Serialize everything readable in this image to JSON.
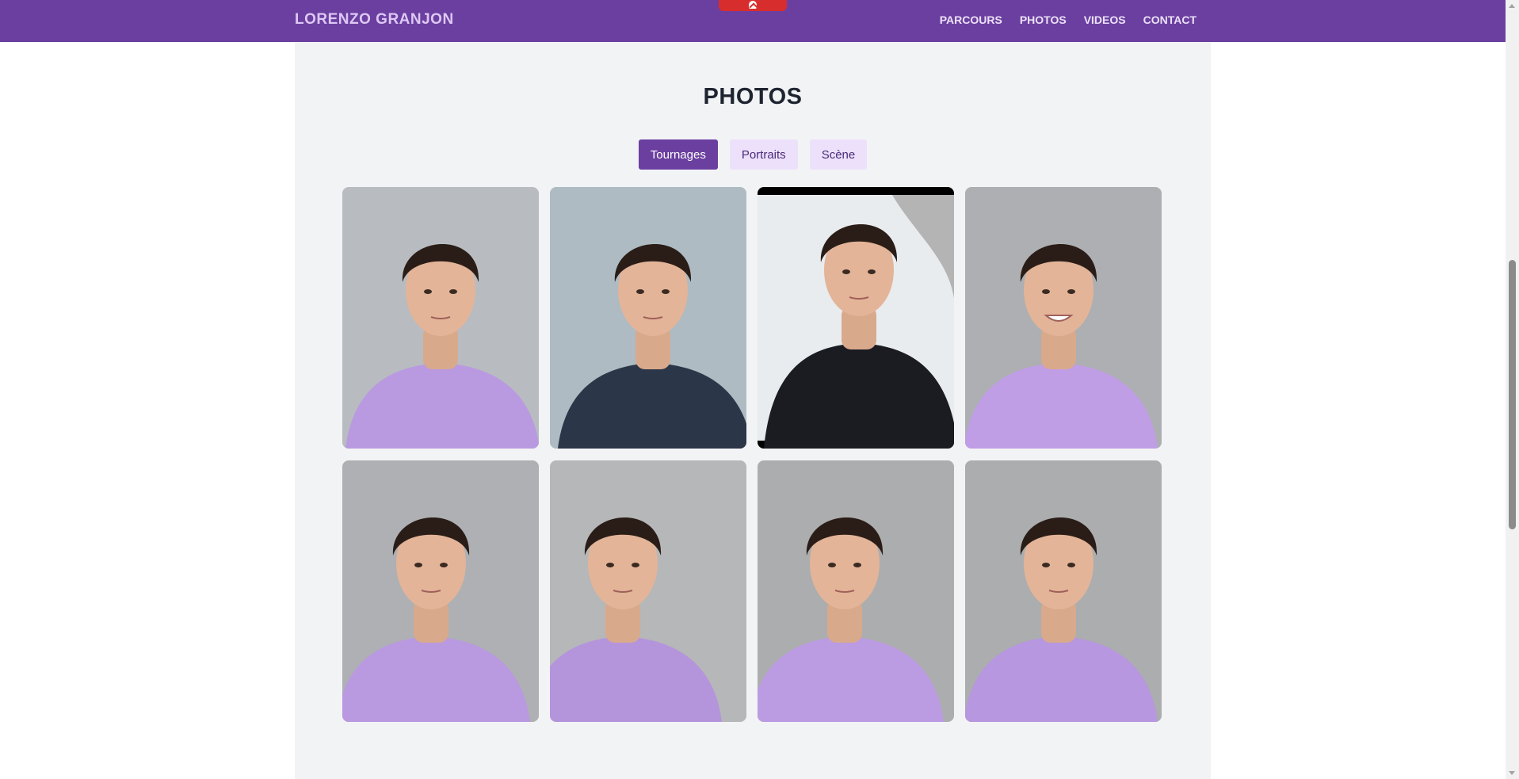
{
  "nav": {
    "brand": "LORENZO GRANJON",
    "links": [
      "PARCOURS",
      "PHOTOS",
      "VIDEOS",
      "CONTACT"
    ],
    "accent_color": "#6b3fa0"
  },
  "scroll_top_button": {
    "icon": "chevron-up-icon",
    "color": "#d82d2d"
  },
  "section": {
    "title": "PHOTOS",
    "filters": [
      {
        "label": "Tournages",
        "active": true
      },
      {
        "label": "Portraits",
        "active": false
      },
      {
        "label": "Scène",
        "active": false
      }
    ]
  },
  "photos": [
    {
      "description": "portrait-lilac-tshirt-front",
      "bg": "#b4b8bd",
      "shirt": "#b99ae0"
    },
    {
      "description": "portrait-dark-jacket-tilted",
      "bg": "#a9b7c0",
      "shirt": "#2b3648"
    },
    {
      "description": "outdoor-black-sweatshirt",
      "bg": "#e8ecef",
      "shirt": "#1a1c22"
    },
    {
      "description": "portrait-lilac-tshirt-smiling",
      "bg": "#a8abae",
      "shirt": "#bf9ee6"
    },
    {
      "description": "portrait-lilac-tshirt-close",
      "bg": "#a9acaf",
      "shirt": "#b99ae0"
    },
    {
      "description": "portrait-lilac-tshirt-profile",
      "bg": "#b2b3b4",
      "shirt": "#b495dc"
    },
    {
      "description": "portrait-lilac-tshirt-looking-down",
      "bg": "#a7a8a9",
      "shirt": "#bb9be2"
    },
    {
      "description": "portrait-lilac-tshirt-straight",
      "bg": "#a6a8aa",
      "shirt": "#b797df"
    }
  ]
}
